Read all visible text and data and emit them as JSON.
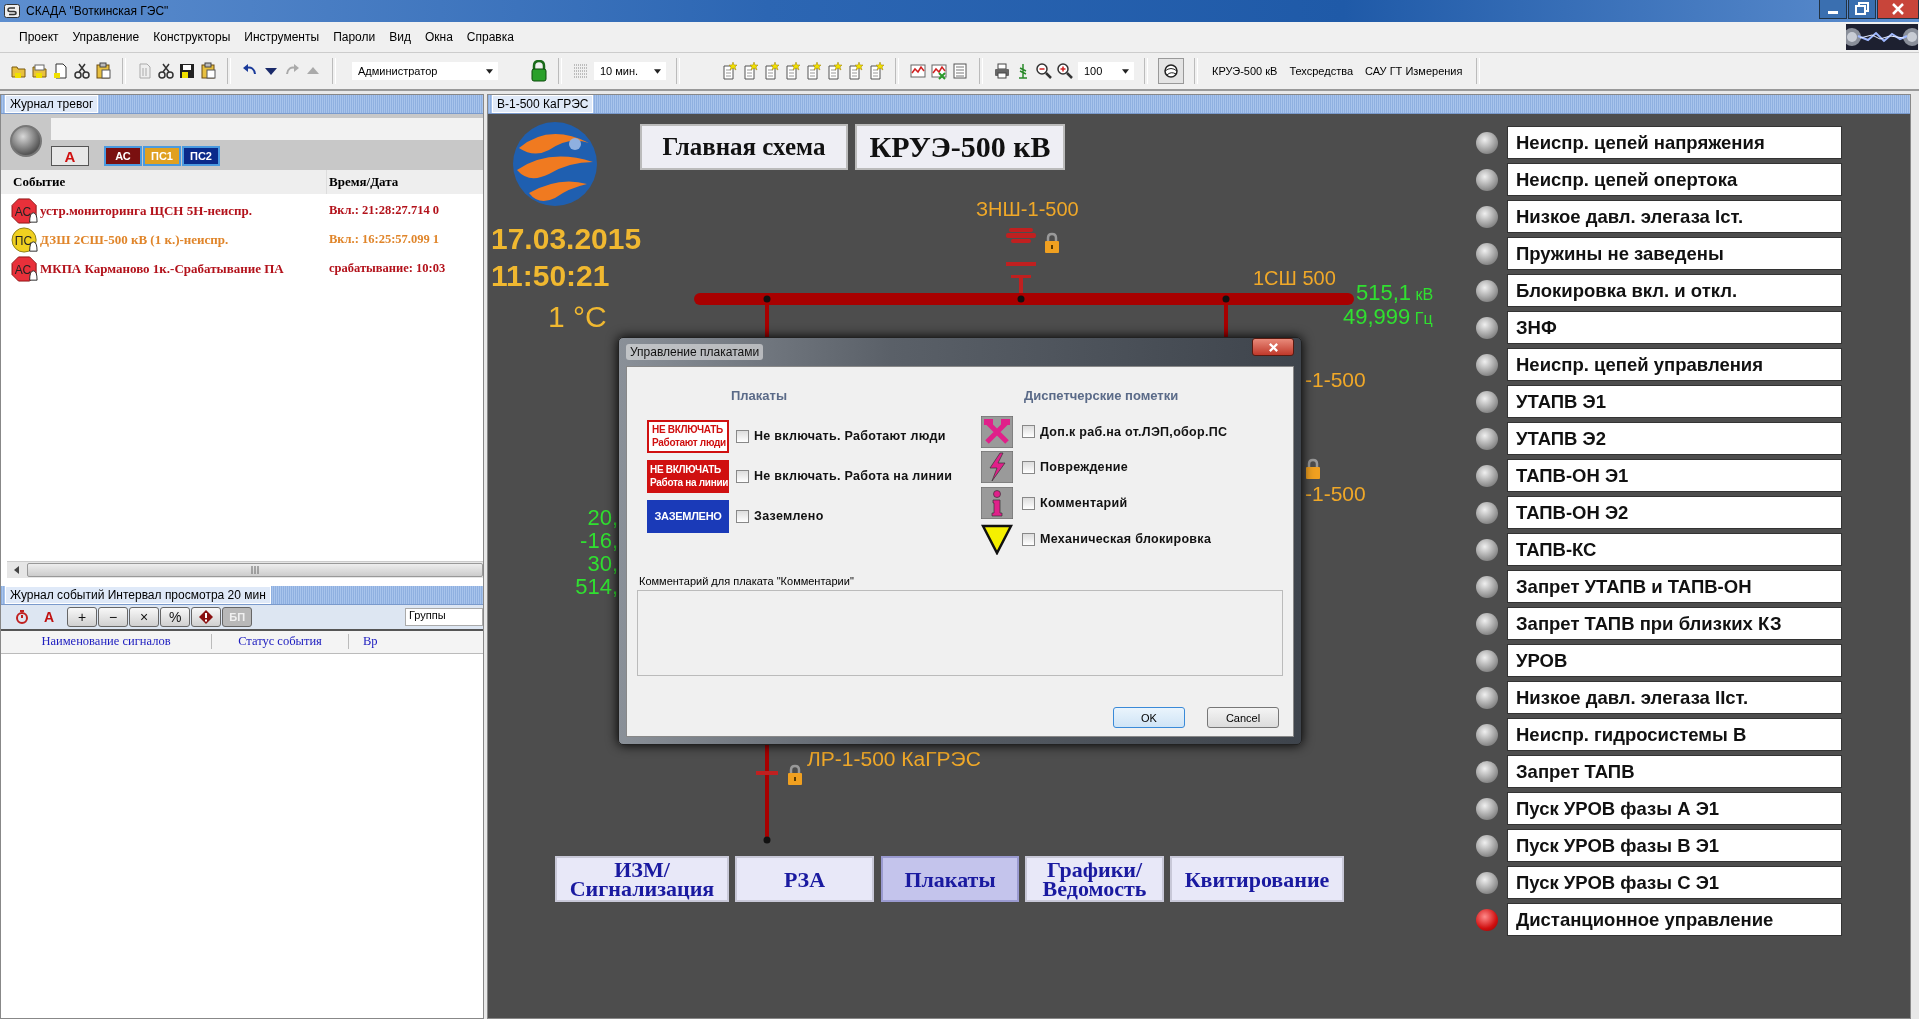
{
  "window": {
    "title": "СКАДА \"Воткинская ГЭС\""
  },
  "menu": [
    "Проект",
    "Управление",
    "Конструкторы",
    "Инструменты",
    "Пароли",
    "Вид",
    "Окна",
    "Справка"
  ],
  "toolbar": {
    "user": "Администратор",
    "interval": "10 мин.",
    "zoom": "100",
    "links": [
      "КРУЭ-500 кВ",
      "Техсредства",
      "САУ ГТ Измерения"
    ]
  },
  "alarm_journal": {
    "title": "Журнал тревог",
    "filters": [
      {
        "label": "A",
        "kind": "letter"
      },
      {
        "label": "АС",
        "kind": "ac"
      },
      {
        "label": "ПС1",
        "kind": "ps1"
      },
      {
        "label": "ПС2",
        "kind": "ps2"
      }
    ],
    "columns": [
      "Событие",
      "Время/Дата"
    ],
    "rows": [
      {
        "badge": "АС",
        "kind": "alarm",
        "event": "устр.мониторинга ЩСН 5Н-неиспр.",
        "time": "Вкл.: 21:28:27.714 0",
        "color": "#b3121b"
      },
      {
        "badge": "ПС",
        "kind": "warning",
        "event": "ДЗШ 2СШ-500 кВ (1 к.)-неиспр.",
        "time": "Вкл.: 16:25:57.099 1",
        "color": "#e0852a"
      },
      {
        "badge": "АС",
        "kind": "alarm",
        "event": "МКПА Карманово 1к.-Срабатывание ПА",
        "time": "срабатывание: 10:03",
        "color": "#b3121b"
      }
    ]
  },
  "event_journal": {
    "title": "Журнал событий Интервал просмотра  20  мин",
    "letter": "A",
    "buttons": [
      {
        "kind": "text",
        "label": "+",
        "disabled": false
      },
      {
        "kind": "text",
        "label": "−",
        "disabled": false
      },
      {
        "kind": "text",
        "label": "×",
        "disabled": false
      },
      {
        "kind": "text",
        "label": "%",
        "disabled": false
      },
      {
        "kind": "warning",
        "disabled": false
      },
      {
        "kind": "text",
        "label": "БП",
        "disabled": true
      }
    ],
    "groups": "Группы",
    "columns": [
      "Наименование сигналов",
      "Статус события",
      "Вр"
    ]
  },
  "scheme": {
    "tab": "В-1-500 КаГРЭС",
    "title_buttons": [
      "Главная схема",
      "КРУЭ-500 кВ"
    ],
    "date": "17.03.2015",
    "time": "11:50:21",
    "temperature": "1 °C",
    "grounding_switch": "ЗНШ-1-500",
    "bus": {
      "name": "1СШ 500",
      "voltage": "515,1",
      "voltage_unit": "кВ",
      "frequency": "49,999",
      "frequency_unit": "Гц"
    },
    "line_labels": [
      "-1-500",
      "-1-500"
    ],
    "measurements": [
      "20,",
      "-16,",
      "30,",
      "514,"
    ],
    "disconnector": "ЛР-1-500 КаГРЭС",
    "nav_buttons": [
      {
        "label": "ИЗМ/\nСигнализация",
        "selected": false
      },
      {
        "label": "РЗА",
        "selected": false
      },
      {
        "label": "Плакаты",
        "selected": true
      },
      {
        "label": "Графики/\nВедомость",
        "selected": false
      },
      {
        "label": "Квитирование",
        "selected": false
      }
    ],
    "signals": [
      {
        "label": "Неиспр. цепей напряжения",
        "on": false
      },
      {
        "label": "Неиспр. цепей опертока",
        "on": false
      },
      {
        "label": "Низкое давл. элегаза Iст.",
        "on": false
      },
      {
        "label": "Пружины не заведены",
        "on": false
      },
      {
        "label": "Блокировка вкл. и откл.",
        "on": false
      },
      {
        "label": "ЗНФ",
        "on": false
      },
      {
        "label": "Неиспр. цепей управления",
        "on": false
      },
      {
        "label": "УТАПВ Э1",
        "on": false
      },
      {
        "label": "УТАПВ Э2",
        "on": false
      },
      {
        "label": "ТАПВ-ОН Э1",
        "on": false
      },
      {
        "label": "ТАПВ-ОН Э2",
        "on": false
      },
      {
        "label": "ТАПВ-КС",
        "on": false
      },
      {
        "label": "Запрет УТАПВ и ТАПВ-ОН",
        "on": false
      },
      {
        "label": "Запрет ТАПВ при близких КЗ",
        "on": false
      },
      {
        "label": "УРОВ",
        "on": false
      },
      {
        "label": "Низкое давл. элегаза IIст.",
        "on": false
      },
      {
        "label": "Неиспр. гидросистемы В",
        "on": false
      },
      {
        "label": "Запрет ТАПВ",
        "on": false
      },
      {
        "label": "Пуск УРОВ фазы А Э1",
        "on": false
      },
      {
        "label": "Пуск УРОВ фазы В Э1",
        "on": false
      },
      {
        "label": "Пуск УРОВ фазы С Э1",
        "on": false
      },
      {
        "label": "Дистанционное управление",
        "on": true
      }
    ]
  },
  "dialog": {
    "title": "Управление плакатами",
    "posters_heading": "Плакаты",
    "posters": [
      {
        "sign": "НЕ ВКЛЮЧАТЬ\nРаботают люди",
        "kind": "outline",
        "label": "Не включать. Работают люди",
        "checked": false
      },
      {
        "sign": "НЕ ВКЛЮЧАТЬ\nРабота на линии",
        "kind": "filled",
        "label": "Не включать. Работа на линии",
        "checked": false
      },
      {
        "sign": "ЗАЗЕМЛЕНО",
        "kind": "ground",
        "label": "Заземлено",
        "checked": false
      }
    ],
    "notes_heading": "Диспетчерские пометки",
    "notes": [
      {
        "kind": "tools",
        "label": "Доп.к раб.на от.ЛЭП,обор.ПС",
        "checked": false
      },
      {
        "kind": "lightning",
        "label": "Повреждение",
        "checked": false
      },
      {
        "kind": "info",
        "label": "Комментарий",
        "checked": false
      },
      {
        "kind": "triangle",
        "label": "Механическая блокировка",
        "checked": false
      }
    ],
    "comment_label": "Комментарий для плаката \"Комментарии\"",
    "buttons": [
      "OK",
      "Cancel"
    ]
  }
}
